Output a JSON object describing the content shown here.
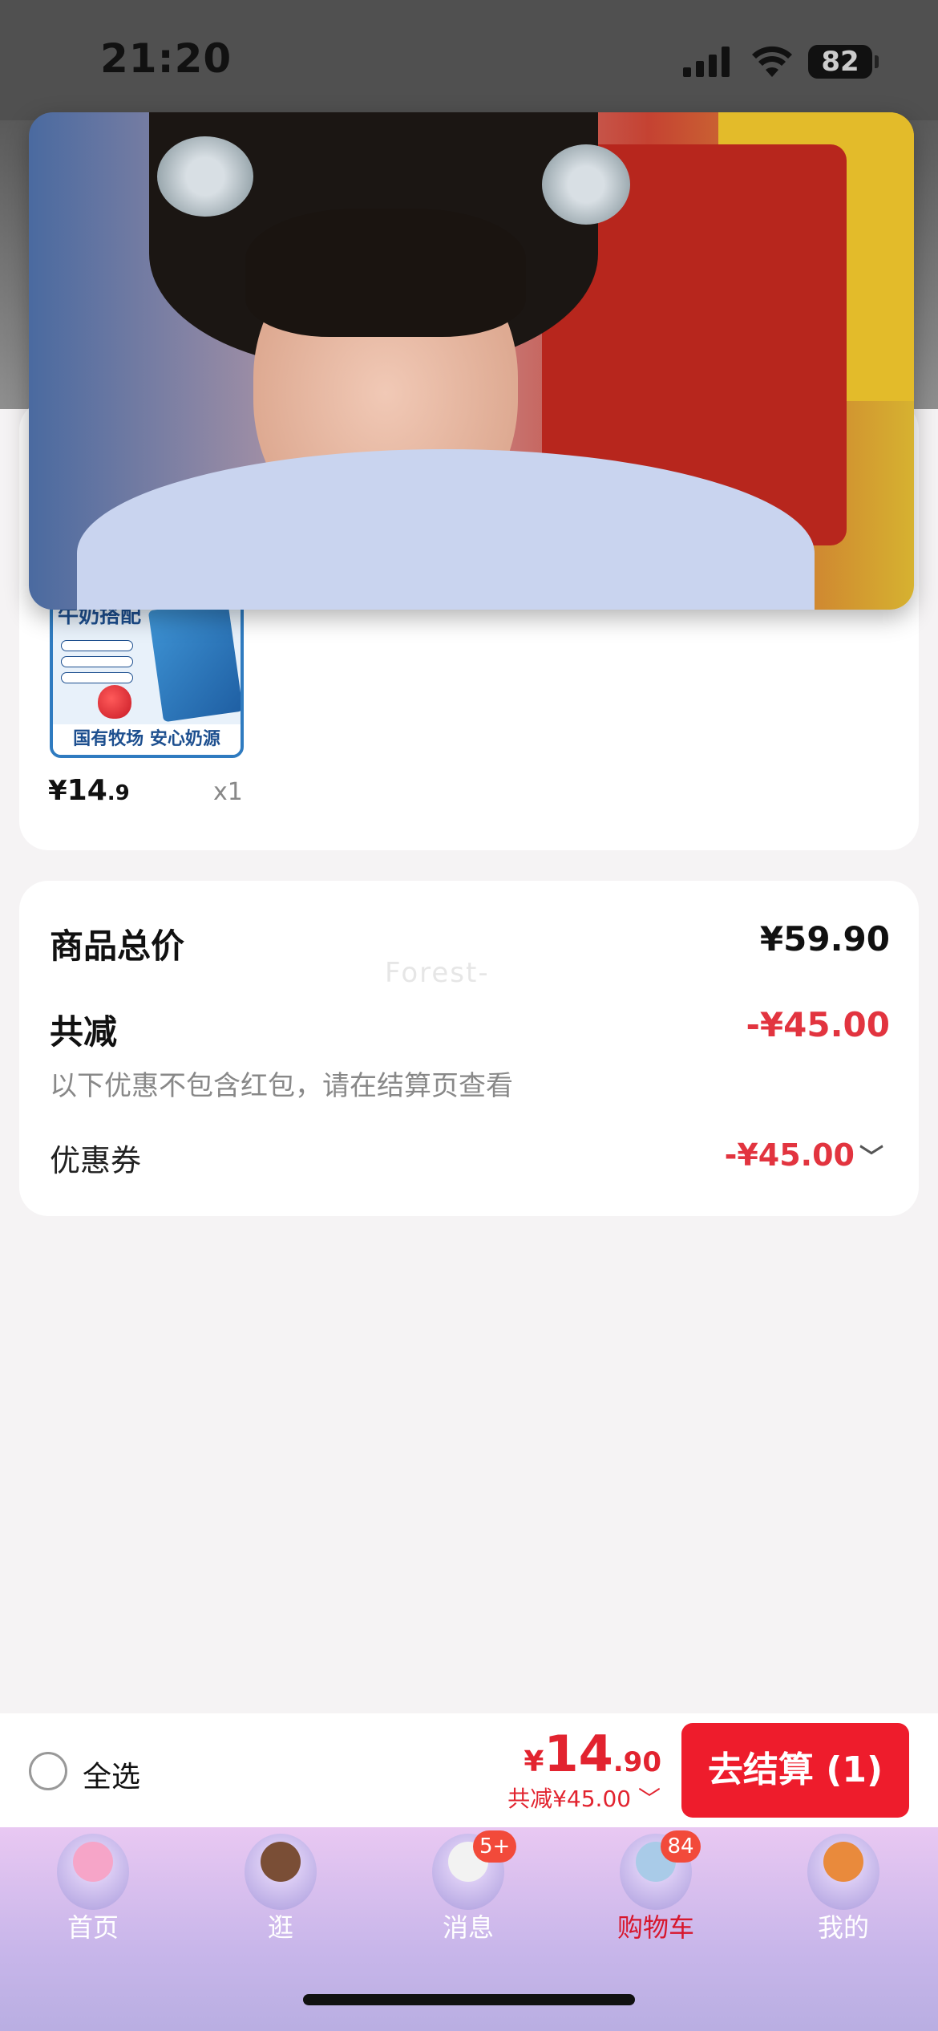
{
  "status_bar": {
    "time": "21:20",
    "battery": "82"
  },
  "product": {
    "image_text_top": "牛奶搭配",
    "image_text_bottom": "国有牧场 安心奶源",
    "price_currency": "¥",
    "price_int": "14",
    "price_dec": ".9",
    "quantity": "x1"
  },
  "summary": {
    "total_label": "商品总价",
    "total_value": "¥59.90",
    "reduction_label": "共减",
    "reduction_value": "-¥45.00",
    "note": "以下优惠不包含红包，请在结算页查看",
    "coupon_label": "优惠券",
    "coupon_value": "-¥45.00"
  },
  "watermark": "Forest-",
  "action_bar": {
    "select_all": "全选",
    "total_currency": "¥",
    "total_int": "14",
    "total_dec": ".90",
    "discount_line": "共减¥45.00",
    "checkout_label": "去结算 (1)"
  },
  "tabs": [
    {
      "label": "首页",
      "badge": ""
    },
    {
      "label": "逛",
      "badge": ""
    },
    {
      "label": "消息",
      "badge": "5+"
    },
    {
      "label": "购物车",
      "badge": "84"
    },
    {
      "label": "我的",
      "badge": ""
    }
  ],
  "colors": {
    "accent_red": "#ee1c2c",
    "price_red": "#e2232f",
    "tab_active": "#d7172d"
  },
  "icons": [
    "cellular-signal-icon",
    "wifi-icon",
    "battery-icon",
    "chevron-down-icon"
  ]
}
